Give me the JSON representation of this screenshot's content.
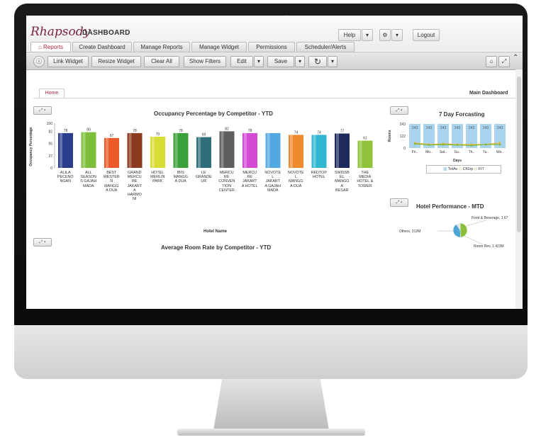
{
  "app": {
    "logo_script": "Rhapsody",
    "logo_word": "DASHBOARD"
  },
  "top_actions": {
    "help": "Help",
    "settings_icon": "gear-icon",
    "logout": "Logout"
  },
  "tabs": [
    {
      "label": "Reports",
      "active": true
    },
    {
      "label": "Create Dashboard"
    },
    {
      "label": "Manage Reports"
    },
    {
      "label": "Manage Widget"
    },
    {
      "label": "Permissions"
    },
    {
      "label": "Scheduler/Alerts"
    }
  ],
  "toolbar": {
    "link_widget": "Link Widget",
    "resize_widget": "Resize Widget",
    "clear_all": "Clear All",
    "show_filters": "Show Filters",
    "edit": "Edit",
    "save": "Save"
  },
  "page": {
    "home_tab": "Home",
    "main_dashboard": "Main Dashboard"
  },
  "occupancy": {
    "chart_data": {
      "type": "bar",
      "title": "Occupancy Percentage by Competitor - YTD",
      "xlabel": "Hotel Name",
      "ylabel": "Occupancy Percentage",
      "ylim": [
        0,
        100
      ],
      "yticks": [
        "100",
        "82",
        "55",
        "27",
        "0"
      ],
      "categories": [
        "ALILA PECENONGAN",
        "ALL SEASONS GAJAH MADA",
        "BEST WESTERN MANGGA DUA",
        "GRAND MERCURE JAKARTA HARMONI",
        "HOTEL MERLIN PARK",
        "IBIS MANGGA DUA",
        "LE GRANDEUR",
        "MERCURE CONVENTION CENTER",
        "MERCURE JAKARTA HOTEL",
        "NOVOTEL JAKARTA GAJAH MADA",
        "NOVOTEL MANGGA DUA",
        "REDTOP HOTEL",
        "SWISSBEL MANGGA BESAR",
        "THE MEDIA HOTEL & TOWER"
      ],
      "category_lines": [
        [
          "ALILA",
          "PECENO",
          "NGAN"
        ],
        [
          "ALL",
          "SEASON",
          "S GAJAH",
          "MADA"
        ],
        [
          "BEST",
          "WESTER",
          "N",
          "MANGG",
          "A DUA"
        ],
        [
          "GRAND",
          "MERCU",
          "RE",
          "JAKART",
          "A",
          "HARMO",
          "NI"
        ],
        [
          "HOTEL",
          "MERLIN",
          "PARK"
        ],
        [
          "IBIS",
          "MANGG",
          "A DUA"
        ],
        [
          "LE",
          "GRANDE",
          "UR"
        ],
        [
          "MERCU",
          "RE",
          "CONVEN",
          "TION",
          "CENTER"
        ],
        [
          "MERCU",
          "RE",
          "JAKART",
          "A HOTEL"
        ],
        [
          "NOVOTE",
          "L",
          "JAKART",
          "A GAJAH",
          "MADA"
        ],
        [
          "NOVOTE",
          "L",
          "MANGG",
          "A DUA"
        ],
        [
          "REDTOP",
          "HOTEL"
        ],
        [
          "SWISSB",
          "EL",
          "MANGG",
          "A",
          "BESAR"
        ],
        [
          "THE",
          "MEDIA",
          "HOTEL &",
          "TOWER"
        ]
      ],
      "values": [
        78,
        80,
        67,
        78,
        70,
        78,
        69,
        82,
        78,
        78,
        74,
        74,
        77,
        61
      ],
      "value_labels": [
        "78",
        "80",
        "67",
        "78",
        "70",
        "78",
        "69",
        "82",
        "78",
        "",
        "74",
        "74",
        "77",
        "61"
      ],
      "colors": [
        "#2a3e8c",
        "#7dbf3a",
        "#ec5a2a",
        "#8b3a1d",
        "#d8dd35",
        "#3aa13a",
        "#2f6f7c",
        "#5e5e5e",
        "#d44ad4",
        "#52a9e2",
        "#f08a2e",
        "#31b6d2",
        "#1e2a5c",
        "#8ec33a"
      ],
      "grid": false,
      "legend": "none"
    }
  },
  "forecast": {
    "chart_data": {
      "type": "bar",
      "title": "7 Day Forcasting",
      "xlabel": "Days",
      "ylabel": "Rooms",
      "yticks": [
        "243",
        "122",
        "0"
      ],
      "categories": [
        "Fri..",
        "Mo..",
        "Sat..",
        "Su..",
        "Th..",
        "Tu..",
        "We.."
      ],
      "series": [
        {
          "name": "TotAv",
          "values": [
            243,
            243,
            243,
            243,
            243,
            243,
            243
          ]
        },
        {
          "name": "CfGrp",
          "values": [
            52,
            36,
            43,
            36,
            35,
            37,
            52
          ]
        },
        {
          "name": "FIT",
          "values": [
            43,
            31,
            35,
            31,
            25,
            36,
            36
          ]
        }
      ],
      "bar_labels": [
        "243",
        "243",
        "243",
        "243",
        "243",
        "243",
        "243"
      ],
      "point_labels": [
        "52",
        "41",
        "43",
        "48",
        "37",
        "45",
        "52",
        "43",
        "31",
        "35",
        "31",
        "26",
        "36",
        "36"
      ],
      "legend": "bottom",
      "colors": {
        "bars": "#a9d3ef",
        "line1": "#e6b52e",
        "line2": "#7cba3a"
      }
    }
  },
  "hotel_performance": {
    "chart_data": {
      "type": "pie",
      "title": "Hotel Performance - MTD",
      "slices": [
        {
          "label": "Food & Beverage",
          "value": 1.67,
          "text": "Food & Beverage, 1.67"
        },
        {
          "label": "Room Rev",
          "value": 1.423,
          "text": "Room Rev, 1.423M"
        },
        {
          "label": "Others",
          "value": 0.312,
          "text": "Others, 312M"
        }
      ],
      "colors": [
        "#8ac03c",
        "#4ea6d6",
        "#e3e3e3"
      ]
    }
  },
  "room_rate": {
    "chart_data": {
      "type": "bar",
      "title": "Average Room Rate by Competitor - YTD"
    }
  }
}
